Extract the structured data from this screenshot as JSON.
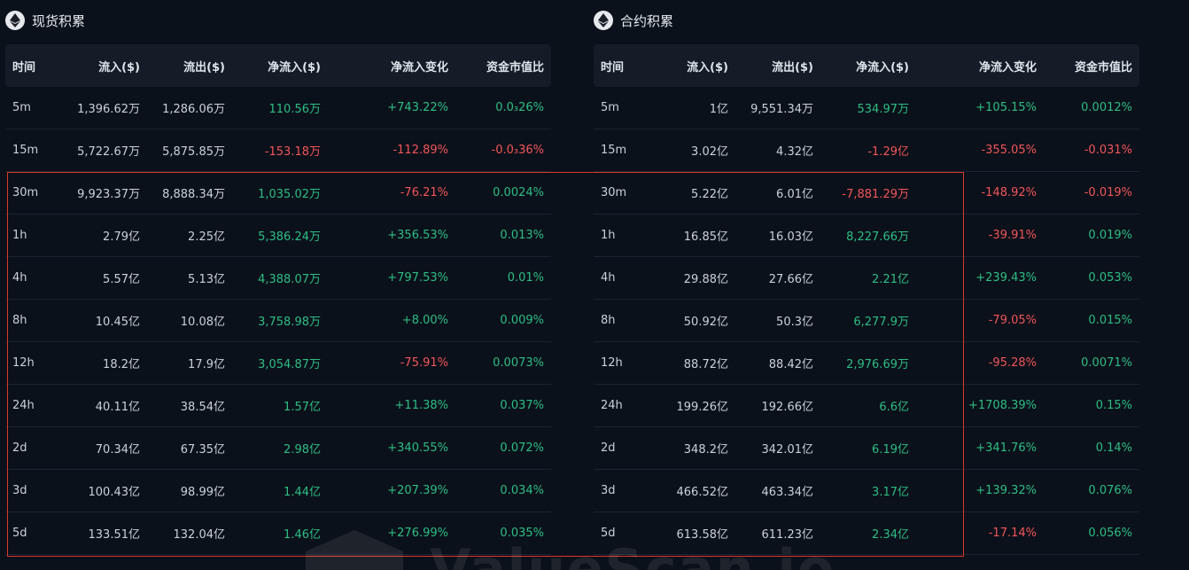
{
  "spot": {
    "title": "现货积累",
    "headers": {
      "time": "时间",
      "inflow": "流入($)",
      "outflow": "流出($)",
      "net": "净流入($)",
      "change": "净流入变化",
      "ratio": "资金市值比"
    },
    "rows": [
      {
        "time": "5m",
        "inflow": "1,396.62万",
        "outflow": "1,286.06万",
        "net": "110.56万",
        "change": "+743.22%",
        "ratio": "0.0₃26%"
      },
      {
        "time": "15m",
        "inflow": "5,722.67万",
        "outflow": "5,875.85万",
        "net": "-153.18万",
        "change": "-112.89%",
        "ratio": "-0.0₃36%"
      },
      {
        "time": "30m",
        "inflow": "9,923.37万",
        "outflow": "8,888.34万",
        "net": "1,035.02万",
        "change": "-76.21%",
        "ratio": "0.0024%"
      },
      {
        "time": "1h",
        "inflow": "2.79亿",
        "outflow": "2.25亿",
        "net": "5,386.24万",
        "change": "+356.53%",
        "ratio": "0.013%"
      },
      {
        "time": "4h",
        "inflow": "5.57亿",
        "outflow": "5.13亿",
        "net": "4,388.07万",
        "change": "+797.53%",
        "ratio": "0.01%"
      },
      {
        "time": "8h",
        "inflow": "10.45亿",
        "outflow": "10.08亿",
        "net": "3,758.98万",
        "change": "+8.00%",
        "ratio": "0.009%"
      },
      {
        "time": "12h",
        "inflow": "18.2亿",
        "outflow": "17.9亿",
        "net": "3,054.87万",
        "change": "-75.91%",
        "ratio": "0.0073%"
      },
      {
        "time": "24h",
        "inflow": "40.11亿",
        "outflow": "38.54亿",
        "net": "1.57亿",
        "change": "+11.38%",
        "ratio": "0.037%"
      },
      {
        "time": "2d",
        "inflow": "70.34亿",
        "outflow": "67.35亿",
        "net": "2.98亿",
        "change": "+340.55%",
        "ratio": "0.072%"
      },
      {
        "time": "3d",
        "inflow": "100.43亿",
        "outflow": "98.99亿",
        "net": "1.44亿",
        "change": "+207.39%",
        "ratio": "0.034%"
      },
      {
        "time": "5d",
        "inflow": "133.51亿",
        "outflow": "132.04亿",
        "net": "1.46亿",
        "change": "+276.99%",
        "ratio": "0.035%"
      }
    ]
  },
  "futures": {
    "title": "合约积累",
    "headers": {
      "time": "时间",
      "inflow": "流入($)",
      "outflow": "流出($)",
      "net": "净流入($)",
      "change": "净流入变化",
      "ratio": "资金市值比"
    },
    "rows": [
      {
        "time": "5m",
        "inflow": "1亿",
        "outflow": "9,551.34万",
        "net": "534.97万",
        "change": "+105.15%",
        "ratio": "0.0012%"
      },
      {
        "time": "15m",
        "inflow": "3.02亿",
        "outflow": "4.32亿",
        "net": "-1.29亿",
        "change": "-355.05%",
        "ratio": "-0.031%"
      },
      {
        "time": "30m",
        "inflow": "5.22亿",
        "outflow": "6.01亿",
        "net": "-7,881.29万",
        "change": "-148.92%",
        "ratio": "-0.019%"
      },
      {
        "time": "1h",
        "inflow": "16.85亿",
        "outflow": "16.03亿",
        "net": "8,227.66万",
        "change": "-39.91%",
        "ratio": "0.019%"
      },
      {
        "time": "4h",
        "inflow": "29.88亿",
        "outflow": "27.66亿",
        "net": "2.21亿",
        "change": "+239.43%",
        "ratio": "0.053%"
      },
      {
        "time": "8h",
        "inflow": "50.92亿",
        "outflow": "50.3亿",
        "net": "6,277.9万",
        "change": "-79.05%",
        "ratio": "0.015%"
      },
      {
        "time": "12h",
        "inflow": "88.72亿",
        "outflow": "88.42亿",
        "net": "2,976.69万",
        "change": "-95.28%",
        "ratio": "0.0071%"
      },
      {
        "time": "24h",
        "inflow": "199.26亿",
        "outflow": "192.66亿",
        "net": "6.6亿",
        "change": "+1708.39%",
        "ratio": "0.15%"
      },
      {
        "time": "2d",
        "inflow": "348.2亿",
        "outflow": "342.01亿",
        "net": "6.19亿",
        "change": "+341.76%",
        "ratio": "0.14%"
      },
      {
        "time": "3d",
        "inflow": "466.52亿",
        "outflow": "463.34亿",
        "net": "3.17亿",
        "change": "+139.32%",
        "ratio": "0.076%"
      },
      {
        "time": "5d",
        "inflow": "613.58亿",
        "outflow": "611.23亿",
        "net": "2.34亿",
        "change": "-17.14%",
        "ratio": "0.056%"
      }
    ]
  },
  "colors": {
    "positive": "#2ebd85",
    "negative": "#f0555a",
    "highlight": "#d9372b"
  },
  "icons": {
    "panel_icon": "ethereum-icon"
  },
  "watermark": "ValueScan.io"
}
